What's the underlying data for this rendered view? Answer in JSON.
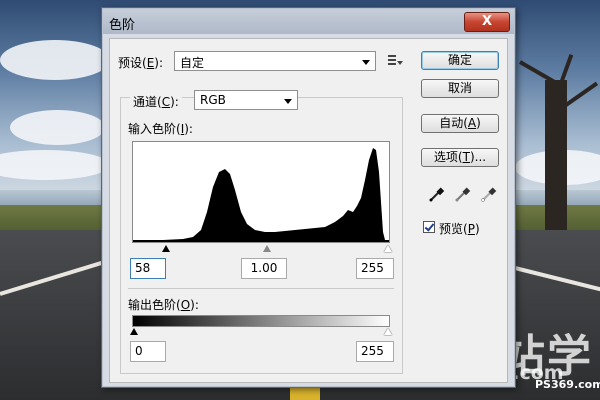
{
  "dialog": {
    "title": "色阶",
    "close_label": "X"
  },
  "preset": {
    "label_pre": "预设(",
    "label_key": "E",
    "label_post": "):",
    "value": "自定"
  },
  "channel": {
    "label_pre": "通道(",
    "label_key": "C",
    "label_post": "):",
    "value": "RGB"
  },
  "input_levels": {
    "label_pre": "输入色阶(",
    "label_key": "I",
    "label_post": "):",
    "black": "58",
    "gamma": "1.00",
    "white": "255"
  },
  "output_levels": {
    "label_pre": "输出色阶(",
    "label_key": "O",
    "label_post": "):",
    "black": "0",
    "white": "255"
  },
  "buttons": {
    "ok": "确定",
    "cancel": "取消",
    "auto_pre": "自动(",
    "auto_key": "A",
    "auto_post": ")",
    "options_pre": "选项(",
    "options_key": "T",
    "options_post": ")..."
  },
  "preview": {
    "label_pre": "预览(",
    "label_key": "P",
    "label_post": ")",
    "checked": true
  },
  "watermark": {
    "big": "建站学",
    "small": "jzxue.com",
    "site": "PS369.com"
  },
  "colors": {
    "dialog_bg": "#d7dbe3",
    "client_bg": "#f0f0f0",
    "close_button": "#c74531",
    "focus_border": "#3c7fb1"
  }
}
